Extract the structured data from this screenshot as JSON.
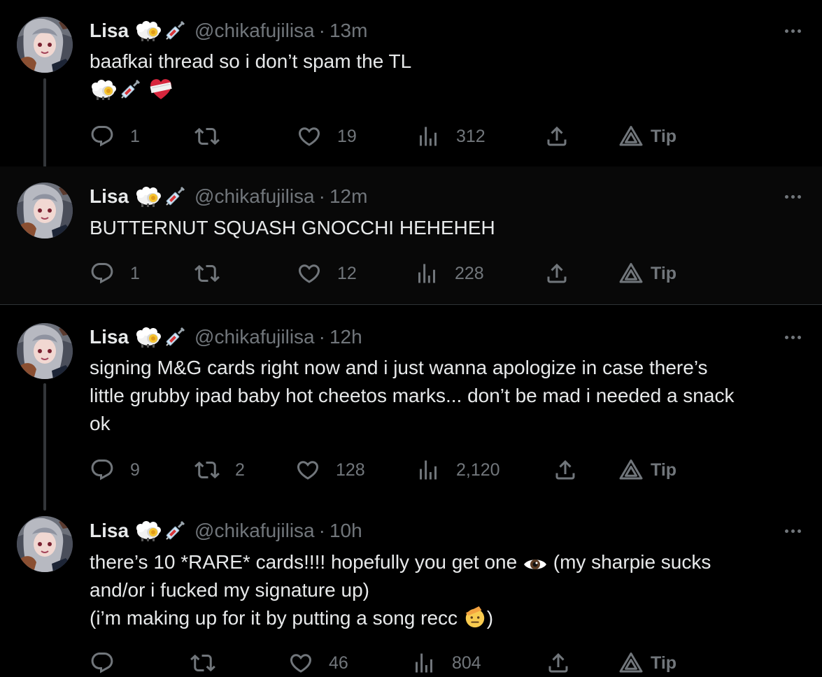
{
  "author": {
    "name": "Lisa",
    "handle": "@chikafujilisa",
    "badges": [
      "sheep-emoji",
      "syringe-emoji"
    ]
  },
  "tweets": [
    {
      "time": "13m",
      "lines": [
        "baafkai thread so i don’t spam the TL"
      ],
      "emoji_line": [
        "sheep-emoji",
        "syringe-emoji",
        "mending-heart-emoji"
      ],
      "replies": "1",
      "retweets": "",
      "likes": "19",
      "views": "312",
      "tip": "Tip"
    },
    {
      "time": "12m",
      "lines": [
        "BUTTERNUT SQUASH GNOCCHI HEHEHEH"
      ],
      "replies": "1",
      "retweets": "",
      "likes": "12",
      "views": "228",
      "tip": "Tip"
    },
    {
      "time": "12h",
      "lines": [
        "signing M&G cards right now and i just wanna apologize in case there’s",
        "little grubby ipad baby hot cheetos marks... don’t be mad i needed a snack",
        "ok"
      ],
      "replies": "9",
      "retweets": "2",
      "likes": "128",
      "views": "2,120",
      "tip": "Tip"
    },
    {
      "time": "10h",
      "line1_a": "there’s 10 *RARE* cards!!!! hopefully you get one",
      "line1_b": "(my sharpie sucks",
      "line2": "and/or i fucked my signature up)",
      "line3_a": "(i’m making up for it by putting a song recc",
      "line3_b": ")",
      "replies": "",
      "retweets": "",
      "likes": "46",
      "views": "804",
      "tip": "Tip"
    }
  ],
  "icons": {
    "eye": "eye-emoji",
    "saluting_face": "saluting-face-emoji"
  }
}
